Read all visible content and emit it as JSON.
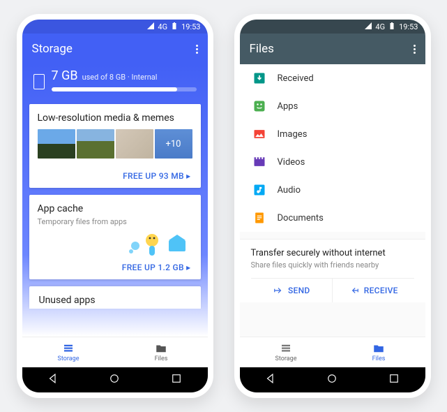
{
  "status": {
    "network": "4G",
    "time": "19:53"
  },
  "left": {
    "title": "Storage",
    "used": "7 GB",
    "used_suffix": "used of 8 GB · Internal",
    "fill_pct": 87,
    "cards": {
      "media": {
        "title": "Low-resolution media & memes",
        "overflow": "+10",
        "action": "FREE UP 93 MB ▸"
      },
      "cache": {
        "title": "App cache",
        "sub": "Temporary files from apps",
        "action": "FREE UP 1.2 GB ▸"
      },
      "unused": {
        "title": "Unused apps"
      }
    },
    "nav": {
      "storage": "Storage",
      "files": "Files"
    }
  },
  "right": {
    "title": "Files",
    "categories": [
      {
        "label": "Received",
        "color": "#009688",
        "icon": "download"
      },
      {
        "label": "Apps",
        "color": "#4caf50",
        "icon": "apps"
      },
      {
        "label": "Images",
        "color": "#f44336",
        "icon": "image"
      },
      {
        "label": "Videos",
        "color": "#673ab7",
        "icon": "video"
      },
      {
        "label": "Audio",
        "color": "#03a9f4",
        "icon": "audio"
      },
      {
        "label": "Documents",
        "color": "#ff9800",
        "icon": "doc"
      }
    ],
    "transfer": {
      "title": "Transfer securely without internet",
      "sub": "Share files quickly with friends nearby",
      "send": "SEND",
      "receive": "RECEIVE"
    },
    "nav": {
      "storage": "Storage",
      "files": "Files"
    }
  }
}
